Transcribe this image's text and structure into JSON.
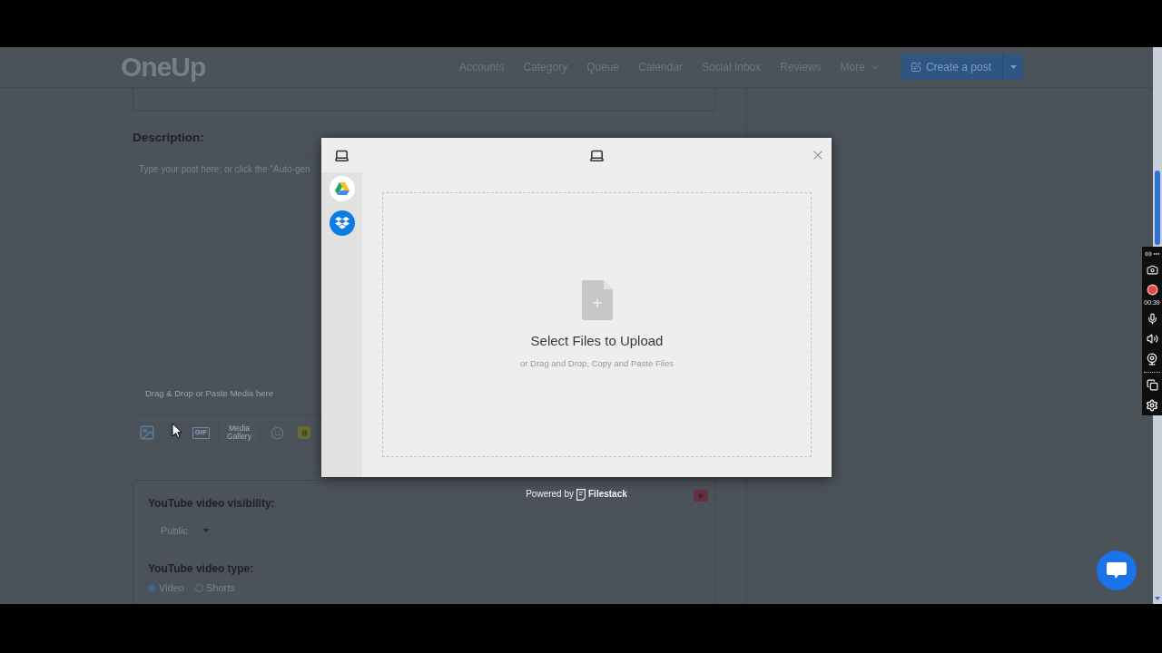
{
  "header": {
    "logo": "OneUp",
    "nav": [
      {
        "label": "Accounts",
        "kind": "link"
      },
      {
        "label": "Category",
        "kind": "link"
      },
      {
        "label": "Queue",
        "kind": "link"
      },
      {
        "label": "Calendar",
        "kind": "link"
      },
      {
        "label": "Social Inbox",
        "kind": "link"
      },
      {
        "label": "Reviews",
        "kind": "link"
      },
      {
        "label": "More",
        "kind": "dropdown"
      }
    ],
    "create_button": "Create a post"
  },
  "editor": {
    "description_label": "Description:",
    "placeholder": "Type your post here; or click the \"Auto-gen",
    "drop_hint": "Drag & Drop or Paste Media here",
    "gif_label": "GIF",
    "media_gallery": "Media Gallery"
  },
  "youtube": {
    "visibility_label": "YouTube video visibility:",
    "visibility_value": "Public",
    "type_label": "YouTube video type:",
    "type_options": [
      {
        "label": "Video",
        "selected": true
      },
      {
        "label": "Shorts",
        "selected": false
      }
    ]
  },
  "upload_dialog": {
    "title": "Select Files to Upload",
    "subtitle": "or Drag and Drop, Copy and Paste Files",
    "powered_by": "Powered by",
    "brand": "Filestack"
  },
  "recorder": {
    "timer": "00:39"
  }
}
